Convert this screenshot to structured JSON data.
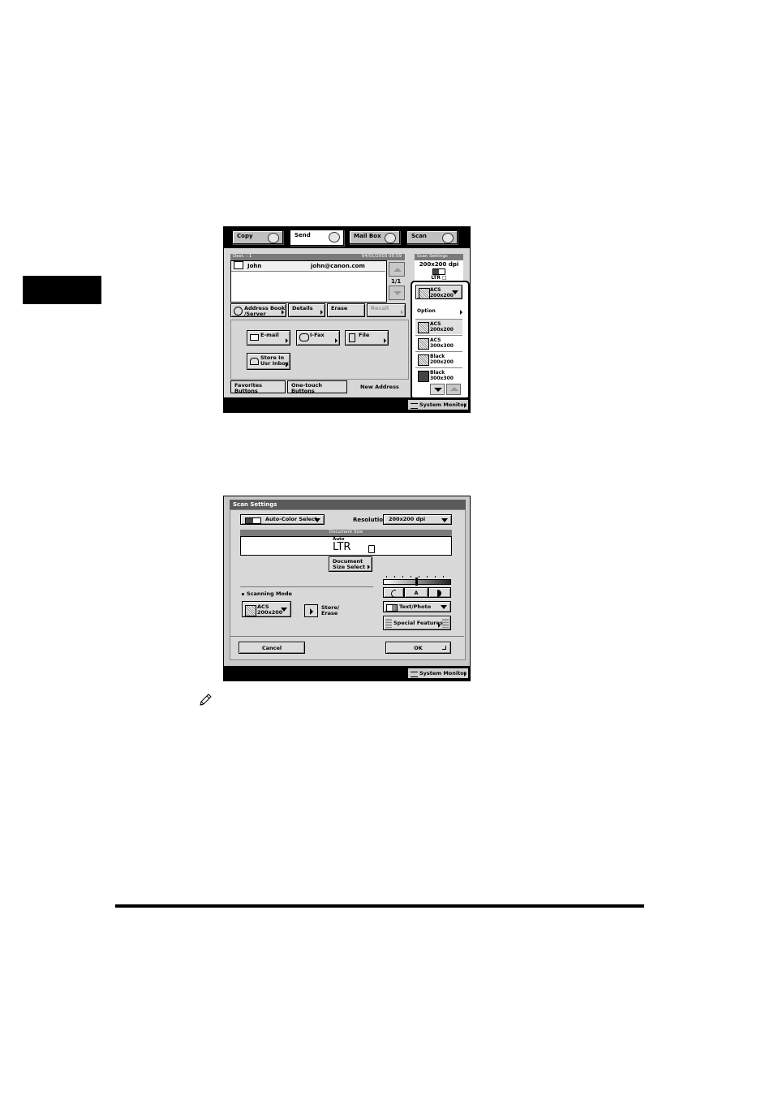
{
  "screen1": {
    "tabs": [
      "Copy",
      "Send",
      "Mail Box",
      "Scan"
    ],
    "status_left": "Dest. :   1",
    "status_right": "04/01/2003 00:59",
    "entry": {
      "name": "John",
      "email": "john@canon.com"
    },
    "page_counter": "1/1",
    "scan_settings_header": "Scan Settings",
    "resolution": "200x200 dpi",
    "size_line": "LTR  □",
    "current_mode": "ACS\n200x200",
    "action_buttons": [
      "Address Book\n/Server",
      "Details",
      "Erase",
      "Recall"
    ],
    "send_buttons": [
      "E-mail",
      "I-Fax",
      "File"
    ],
    "store_button": "Store In\nUsr Inbox",
    "bottom_tabs": [
      "Favorites Buttons",
      "One-touch Buttons",
      "New Address"
    ],
    "dropdown": {
      "option": "Option",
      "items": [
        "ACS\n200x200",
        "ACS\n300x300",
        "Black\n200x200",
        "Black\n300x300"
      ]
    },
    "system_monitor": "System Monitor"
  },
  "screen2": {
    "title": "Scan Settings",
    "color_select": "Auto-Color Select",
    "resolution_label": "Resolution:",
    "resolution_value": "200x200 dpi",
    "doc_size_header": "Document Size",
    "doc_size_auto": "Auto",
    "doc_size_value": "LTR",
    "doc_size_button": "Document\nSize Select",
    "scanning_mode_label": "Scanning Mode",
    "scanning_mode_value": "ACS\n200x200",
    "store_erase": "Store/\nErase",
    "exposure_auto": "A",
    "image_type": "Text/Photo",
    "special_features": "Special Features",
    "cancel": "Cancel",
    "ok": "OK",
    "system_monitor": "System Monitor"
  }
}
